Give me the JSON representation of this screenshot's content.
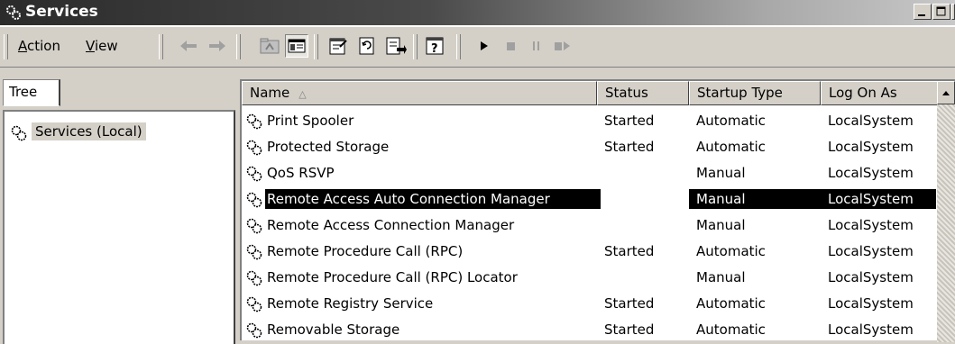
{
  "window": {
    "title": "Services"
  },
  "menu": {
    "action": {
      "accel": "A",
      "rest": "ction"
    },
    "view": {
      "accel": "V",
      "rest": "iew"
    }
  },
  "toolbar_icons": [
    "back-arrow-icon",
    "forward-arrow-icon",
    "up-folder-icon",
    "show-hide-tree-icon",
    "properties-icon",
    "refresh-icon",
    "export-list-icon",
    "help-icon",
    "start-service-icon",
    "stop-service-icon",
    "pause-service-icon",
    "restart-service-icon"
  ],
  "tree": {
    "tab_label": "Tree",
    "root_label": "Services (Local)"
  },
  "columns": {
    "name": "Name",
    "status": "Status",
    "startup_type": "Startup Type",
    "log_on_as": "Log On As"
  },
  "sort": {
    "column": "name",
    "direction": "ascending"
  },
  "services": [
    {
      "name": "Print Spooler",
      "status": "Started",
      "startup": "Automatic",
      "logon": "LocalSystem"
    },
    {
      "name": "Protected Storage",
      "status": "Started",
      "startup": "Automatic",
      "logon": "LocalSystem"
    },
    {
      "name": "QoS RSVP",
      "status": "",
      "startup": "Manual",
      "logon": "LocalSystem"
    },
    {
      "name": "Remote Access Auto Connection Manager",
      "status": "",
      "startup": "Manual",
      "logon": "LocalSystem",
      "selected": true
    },
    {
      "name": "Remote Access Connection Manager",
      "status": "",
      "startup": "Manual",
      "logon": "LocalSystem"
    },
    {
      "name": "Remote Procedure Call (RPC)",
      "status": "Started",
      "startup": "Automatic",
      "logon": "LocalSystem"
    },
    {
      "name": "Remote Procedure Call (RPC) Locator",
      "status": "",
      "startup": "Manual",
      "logon": "LocalSystem"
    },
    {
      "name": "Remote Registry Service",
      "status": "Started",
      "startup": "Automatic",
      "logon": "LocalSystem"
    },
    {
      "name": "Removable Storage",
      "status": "Started",
      "startup": "Automatic",
      "logon": "LocalSystem"
    }
  ],
  "colors": {
    "selection": "#000000",
    "face": "#d4d0c8"
  }
}
